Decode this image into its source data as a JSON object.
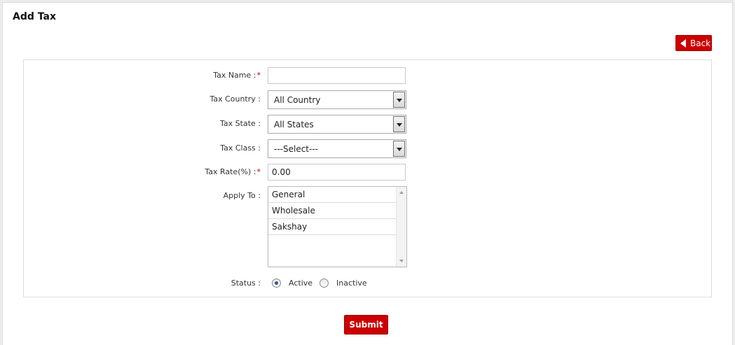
{
  "page": {
    "title": "Add Tax"
  },
  "toolbar": {
    "back_label": "Back"
  },
  "form": {
    "tax_name": {
      "label": "Tax Name :",
      "required": "*",
      "value": ""
    },
    "tax_country": {
      "label": "Tax Country :",
      "value": "All Country"
    },
    "tax_state": {
      "label": "Tax State :",
      "value": "All States"
    },
    "tax_class": {
      "label": "Tax Class :",
      "value": "---Select---"
    },
    "tax_rate": {
      "label": "Tax Rate(%) :",
      "required": "*",
      "value": "0.00"
    },
    "apply_to": {
      "label": "Apply To :",
      "options": [
        "General",
        "Wholesale",
        "Sakshay"
      ]
    },
    "status": {
      "label": "Status :",
      "active_label": "Active",
      "inactive_label": "Inactive",
      "selected": "Active"
    },
    "submit_label": "Submit"
  },
  "colors": {
    "accent": "#cc0000",
    "radio_dot": "#2a5a96"
  }
}
